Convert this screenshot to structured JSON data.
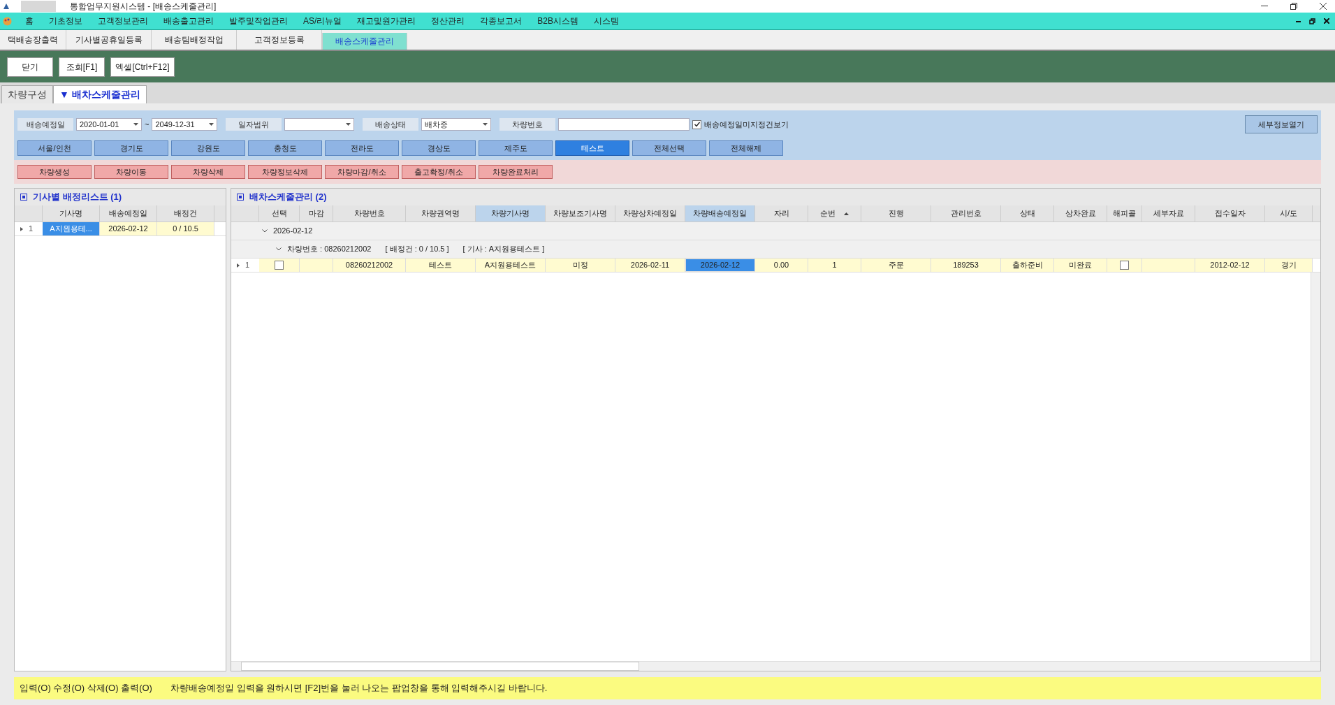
{
  "window": {
    "title": "통합업무지원시스템 - [배송스케줄관리]"
  },
  "menu": [
    "홈",
    "기초정보",
    "고객정보관리",
    "배송출고관리",
    "발주및작업관리",
    "AS/리뉴얼",
    "재고및원가관리",
    "정산관리",
    "각종보고서",
    "B2B시스템",
    "시스템"
  ],
  "doc_tabs": [
    {
      "label": "택배송장출력",
      "selected": false
    },
    {
      "label": "기사별공휴일등록",
      "selected": false
    },
    {
      "label": "배송팀배정작업",
      "selected": false
    },
    {
      "label": "고객정보등록",
      "selected": false
    },
    {
      "label": "배송스케줄관리",
      "selected": true
    }
  ],
  "toolbar": [
    "닫기",
    "조회[F1]",
    "엑셀[Ctrl+F12]"
  ],
  "sub_tabs": [
    {
      "label": "차량구성",
      "selected": false
    },
    {
      "label": "▼ 배차스케줄관리",
      "selected": true
    }
  ],
  "filters": {
    "date_label": "배송예정일",
    "date_from": "2020-01-01",
    "tilde": "~",
    "date_to": "2049-12-31",
    "range_label": "일자범위",
    "status_label": "배송상태",
    "status_value": "배차중",
    "vehicle_label": "차량번호",
    "unassigned": {
      "label": "배송예정일미지정건보기",
      "checked": true
    },
    "detail_button": "세부정보열기"
  },
  "region_buttons": [
    {
      "label": "서울/인천",
      "selected": false
    },
    {
      "label": "경기도",
      "selected": false
    },
    {
      "label": "강원도",
      "selected": false
    },
    {
      "label": "충청도",
      "selected": false
    },
    {
      "label": "전라도",
      "selected": false
    },
    {
      "label": "경상도",
      "selected": false
    },
    {
      "label": "제주도",
      "selected": false
    },
    {
      "label": "테스트",
      "selected": true
    },
    {
      "label": "전체선택",
      "selected": false
    },
    {
      "label": "전체해제",
      "selected": false
    }
  ],
  "action_buttons": [
    "차량생성",
    "차량이동",
    "차량삭제",
    "차량정보삭제",
    "차량마감/취소",
    "출고확정/취소",
    "차량완료처리"
  ],
  "driver_list": {
    "title": "기사별 배정리스트 (1)",
    "columns": [
      "기사명",
      "배송예정일",
      "배정건"
    ],
    "rows": [
      {
        "number": "1",
        "cells": [
          {
            "text": "A지원용테...",
            "selected": true
          },
          {
            "text": "2026-02-12",
            "selected": false
          },
          {
            "text": "0 / 10.5",
            "selected": false
          }
        ]
      }
    ]
  },
  "schedule": {
    "title": "배차스케줄관리 (2)",
    "columns": [
      {
        "label": "선택",
        "highlighted": false,
        "sorted": false
      },
      {
        "label": "마감",
        "highlighted": false,
        "sorted": false
      },
      {
        "label": "차량번호",
        "highlighted": false,
        "sorted": false
      },
      {
        "label": "차량권역명",
        "highlighted": false,
        "sorted": false
      },
      {
        "label": "차량기사명",
        "highlighted": true,
        "sorted": false
      },
      {
        "label": "차량보조기사명",
        "highlighted": false,
        "sorted": false
      },
      {
        "label": "차량상차예정일",
        "highlighted": false,
        "sorted": false
      },
      {
        "label": "차량배송예정일",
        "highlighted": true,
        "sorted": false
      },
      {
        "label": "자리",
        "highlighted": false,
        "sorted": false
      },
      {
        "label": "순번",
        "highlighted": false,
        "sorted": true
      },
      {
        "label": "진행",
        "highlighted": false,
        "sorted": false
      },
      {
        "label": "관리번호",
        "highlighted": false,
        "sorted": false
      },
      {
        "label": "상태",
        "highlighted": false,
        "sorted": false
      },
      {
        "label": "상차완료",
        "highlighted": false,
        "sorted": false
      },
      {
        "label": "해피콜",
        "highlighted": false,
        "sorted": false
      },
      {
        "label": "세부자료",
        "highlighted": false,
        "sorted": false
      },
      {
        "label": "접수일자",
        "highlighted": false,
        "sorted": false
      },
      {
        "label": "시/도",
        "highlighted": false,
        "sorted": false
      }
    ],
    "group": {
      "label": "2026-02-12",
      "expanded": true,
      "subgroup": {
        "expanded": true,
        "parts": [
          "차량번호 : 08260212002",
          "[ 배정건 : 0 / 10.5 ]",
          "[ 기사 : A지원용테스트 ]"
        ]
      }
    },
    "rows": [
      {
        "number": "1",
        "cells": [
          {
            "kind": "checkbox",
            "checked": false
          },
          {
            "kind": "text",
            "text": "",
            "selected": false
          },
          {
            "kind": "text",
            "text": "08260212002",
            "selected": false
          },
          {
            "kind": "text",
            "text": "테스트",
            "selected": false
          },
          {
            "kind": "text",
            "text": "A지원용테스트",
            "selected": false
          },
          {
            "kind": "text",
            "text": "미정",
            "selected": false
          },
          {
            "kind": "text",
            "text": "2026-02-11",
            "selected": false
          },
          {
            "kind": "text",
            "text": "2026-02-12",
            "selected": true
          },
          {
            "kind": "text",
            "text": "0.00",
            "selected": false
          },
          {
            "kind": "text",
            "text": "1",
            "selected": false
          },
          {
            "kind": "text",
            "text": "주문",
            "selected": false
          },
          {
            "kind": "text",
            "text": "189253",
            "selected": false
          },
          {
            "kind": "text",
            "text": "출하준비",
            "selected": false
          },
          {
            "kind": "text",
            "text": "미완료",
            "selected": false
          },
          {
            "kind": "checkbox",
            "checked": false
          },
          {
            "kind": "text",
            "text": "",
            "selected": false
          },
          {
            "kind": "text",
            "text": "2012-02-12",
            "selected": false
          },
          {
            "kind": "text",
            "text": "경기",
            "selected": false
          }
        ]
      }
    ]
  },
  "status_bar": {
    "permissions": "입력(O) 수정(O) 삭제(O) 출력(O)",
    "message": "차량배송예정일 입력을 원하시면 [F2]번을 눌러 나오는 팝업창을 통해 입력해주시길 바랍니다."
  }
}
